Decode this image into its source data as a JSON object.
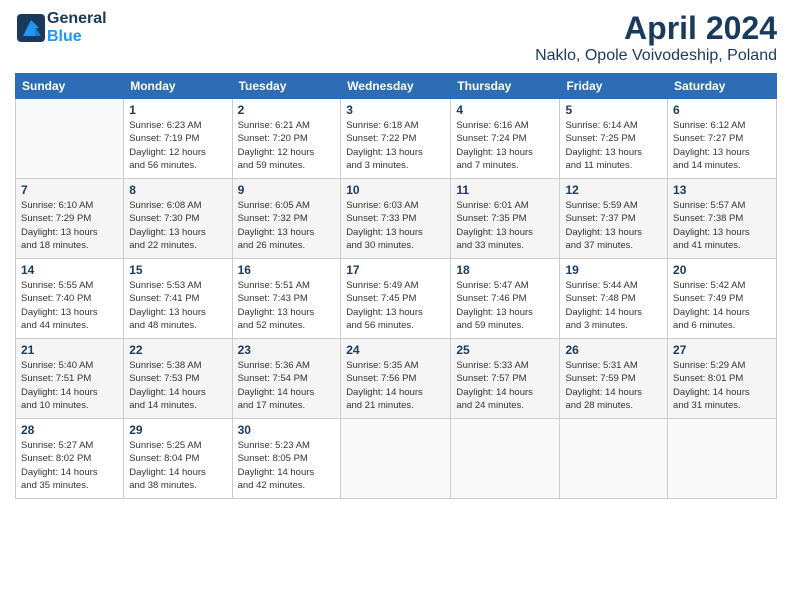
{
  "header": {
    "logo_line1": "General",
    "logo_line2": "Blue",
    "month": "April 2024",
    "location": "Naklo, Opole Voivodeship, Poland"
  },
  "weekdays": [
    "Sunday",
    "Monday",
    "Tuesday",
    "Wednesday",
    "Thursday",
    "Friday",
    "Saturday"
  ],
  "weeks": [
    [
      {
        "day": "",
        "info": ""
      },
      {
        "day": "1",
        "info": "Sunrise: 6:23 AM\nSunset: 7:19 PM\nDaylight: 12 hours\nand 56 minutes."
      },
      {
        "day": "2",
        "info": "Sunrise: 6:21 AM\nSunset: 7:20 PM\nDaylight: 12 hours\nand 59 minutes."
      },
      {
        "day": "3",
        "info": "Sunrise: 6:18 AM\nSunset: 7:22 PM\nDaylight: 13 hours\nand 3 minutes."
      },
      {
        "day": "4",
        "info": "Sunrise: 6:16 AM\nSunset: 7:24 PM\nDaylight: 13 hours\nand 7 minutes."
      },
      {
        "day": "5",
        "info": "Sunrise: 6:14 AM\nSunset: 7:25 PM\nDaylight: 13 hours\nand 11 minutes."
      },
      {
        "day": "6",
        "info": "Sunrise: 6:12 AM\nSunset: 7:27 PM\nDaylight: 13 hours\nand 14 minutes."
      }
    ],
    [
      {
        "day": "7",
        "info": "Sunrise: 6:10 AM\nSunset: 7:29 PM\nDaylight: 13 hours\nand 18 minutes."
      },
      {
        "day": "8",
        "info": "Sunrise: 6:08 AM\nSunset: 7:30 PM\nDaylight: 13 hours\nand 22 minutes."
      },
      {
        "day": "9",
        "info": "Sunrise: 6:05 AM\nSunset: 7:32 PM\nDaylight: 13 hours\nand 26 minutes."
      },
      {
        "day": "10",
        "info": "Sunrise: 6:03 AM\nSunset: 7:33 PM\nDaylight: 13 hours\nand 30 minutes."
      },
      {
        "day": "11",
        "info": "Sunrise: 6:01 AM\nSunset: 7:35 PM\nDaylight: 13 hours\nand 33 minutes."
      },
      {
        "day": "12",
        "info": "Sunrise: 5:59 AM\nSunset: 7:37 PM\nDaylight: 13 hours\nand 37 minutes."
      },
      {
        "day": "13",
        "info": "Sunrise: 5:57 AM\nSunset: 7:38 PM\nDaylight: 13 hours\nand 41 minutes."
      }
    ],
    [
      {
        "day": "14",
        "info": "Sunrise: 5:55 AM\nSunset: 7:40 PM\nDaylight: 13 hours\nand 44 minutes."
      },
      {
        "day": "15",
        "info": "Sunrise: 5:53 AM\nSunset: 7:41 PM\nDaylight: 13 hours\nand 48 minutes."
      },
      {
        "day": "16",
        "info": "Sunrise: 5:51 AM\nSunset: 7:43 PM\nDaylight: 13 hours\nand 52 minutes."
      },
      {
        "day": "17",
        "info": "Sunrise: 5:49 AM\nSunset: 7:45 PM\nDaylight: 13 hours\nand 56 minutes."
      },
      {
        "day": "18",
        "info": "Sunrise: 5:47 AM\nSunset: 7:46 PM\nDaylight: 13 hours\nand 59 minutes."
      },
      {
        "day": "19",
        "info": "Sunrise: 5:44 AM\nSunset: 7:48 PM\nDaylight: 14 hours\nand 3 minutes."
      },
      {
        "day": "20",
        "info": "Sunrise: 5:42 AM\nSunset: 7:49 PM\nDaylight: 14 hours\nand 6 minutes."
      }
    ],
    [
      {
        "day": "21",
        "info": "Sunrise: 5:40 AM\nSunset: 7:51 PM\nDaylight: 14 hours\nand 10 minutes."
      },
      {
        "day": "22",
        "info": "Sunrise: 5:38 AM\nSunset: 7:53 PM\nDaylight: 14 hours\nand 14 minutes."
      },
      {
        "day": "23",
        "info": "Sunrise: 5:36 AM\nSunset: 7:54 PM\nDaylight: 14 hours\nand 17 minutes."
      },
      {
        "day": "24",
        "info": "Sunrise: 5:35 AM\nSunset: 7:56 PM\nDaylight: 14 hours\nand 21 minutes."
      },
      {
        "day": "25",
        "info": "Sunrise: 5:33 AM\nSunset: 7:57 PM\nDaylight: 14 hours\nand 24 minutes."
      },
      {
        "day": "26",
        "info": "Sunrise: 5:31 AM\nSunset: 7:59 PM\nDaylight: 14 hours\nand 28 minutes."
      },
      {
        "day": "27",
        "info": "Sunrise: 5:29 AM\nSunset: 8:01 PM\nDaylight: 14 hours\nand 31 minutes."
      }
    ],
    [
      {
        "day": "28",
        "info": "Sunrise: 5:27 AM\nSunset: 8:02 PM\nDaylight: 14 hours\nand 35 minutes."
      },
      {
        "day": "29",
        "info": "Sunrise: 5:25 AM\nSunset: 8:04 PM\nDaylight: 14 hours\nand 38 minutes."
      },
      {
        "day": "30",
        "info": "Sunrise: 5:23 AM\nSunset: 8:05 PM\nDaylight: 14 hours\nand 42 minutes."
      },
      {
        "day": "",
        "info": ""
      },
      {
        "day": "",
        "info": ""
      },
      {
        "day": "",
        "info": ""
      },
      {
        "day": "",
        "info": ""
      }
    ]
  ]
}
